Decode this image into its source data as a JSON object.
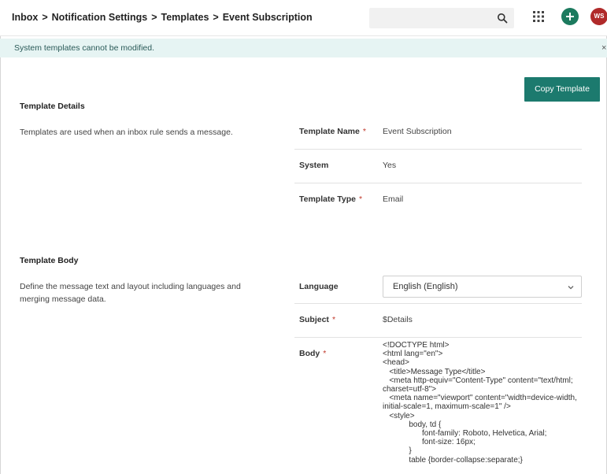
{
  "breadcrumb": [
    "Inbox",
    "Notification Settings",
    "Templates",
    "Event Subscription"
  ],
  "breadcrumb_separator": ">",
  "header": {
    "avatar_initials": "WS",
    "search_placeholder": ""
  },
  "notice": {
    "text": "System templates cannot be modified.",
    "close": "×"
  },
  "copy_button": {
    "label": "Copy Template"
  },
  "details": {
    "title": "Template Details",
    "description": "Templates are used when an inbox rule sends a message.",
    "fields": [
      {
        "label": "Template Name",
        "required": "*",
        "value": "Event Subscription"
      },
      {
        "label": "System",
        "required": "",
        "value": "Yes"
      },
      {
        "label": "Template Type",
        "required": "*",
        "value": "Email"
      }
    ]
  },
  "body_section": {
    "title": "Template Body",
    "description": "Define the message text and layout including languages and merging message data.",
    "language_label": "Language",
    "language_value": "English (English)",
    "subject_label": "Subject",
    "subject_required": "*",
    "subject_value": "$Details",
    "body_label": "Body",
    "body_required": "*",
    "body_code": "<!DOCTYPE html>\n<html lang=\"en\">\n<head>\n   <title>Message Type</title>\n   <meta http-equiv=\"Content-Type\" content=\"text/html; charset=utf-8\">\n   <meta name=\"viewport\" content=\"width=device-width, initial-scale=1, maximum-scale=1\" />\n   <style>\n            body, td {\n                  font-family: Roboto, Helvetica, Arial;\n                  font-size: 16px;\n            }\n            table {border-collapse:separate;}"
  },
  "colors": {
    "accent": "#1c7a6e",
    "notice_bg": "#e6f4f3",
    "avatar_bg": "#b02a2a"
  },
  "icons": [
    "search-icon",
    "apps-grid-icon",
    "plus-icon",
    "chevron-down-icon",
    "close-icon"
  ]
}
